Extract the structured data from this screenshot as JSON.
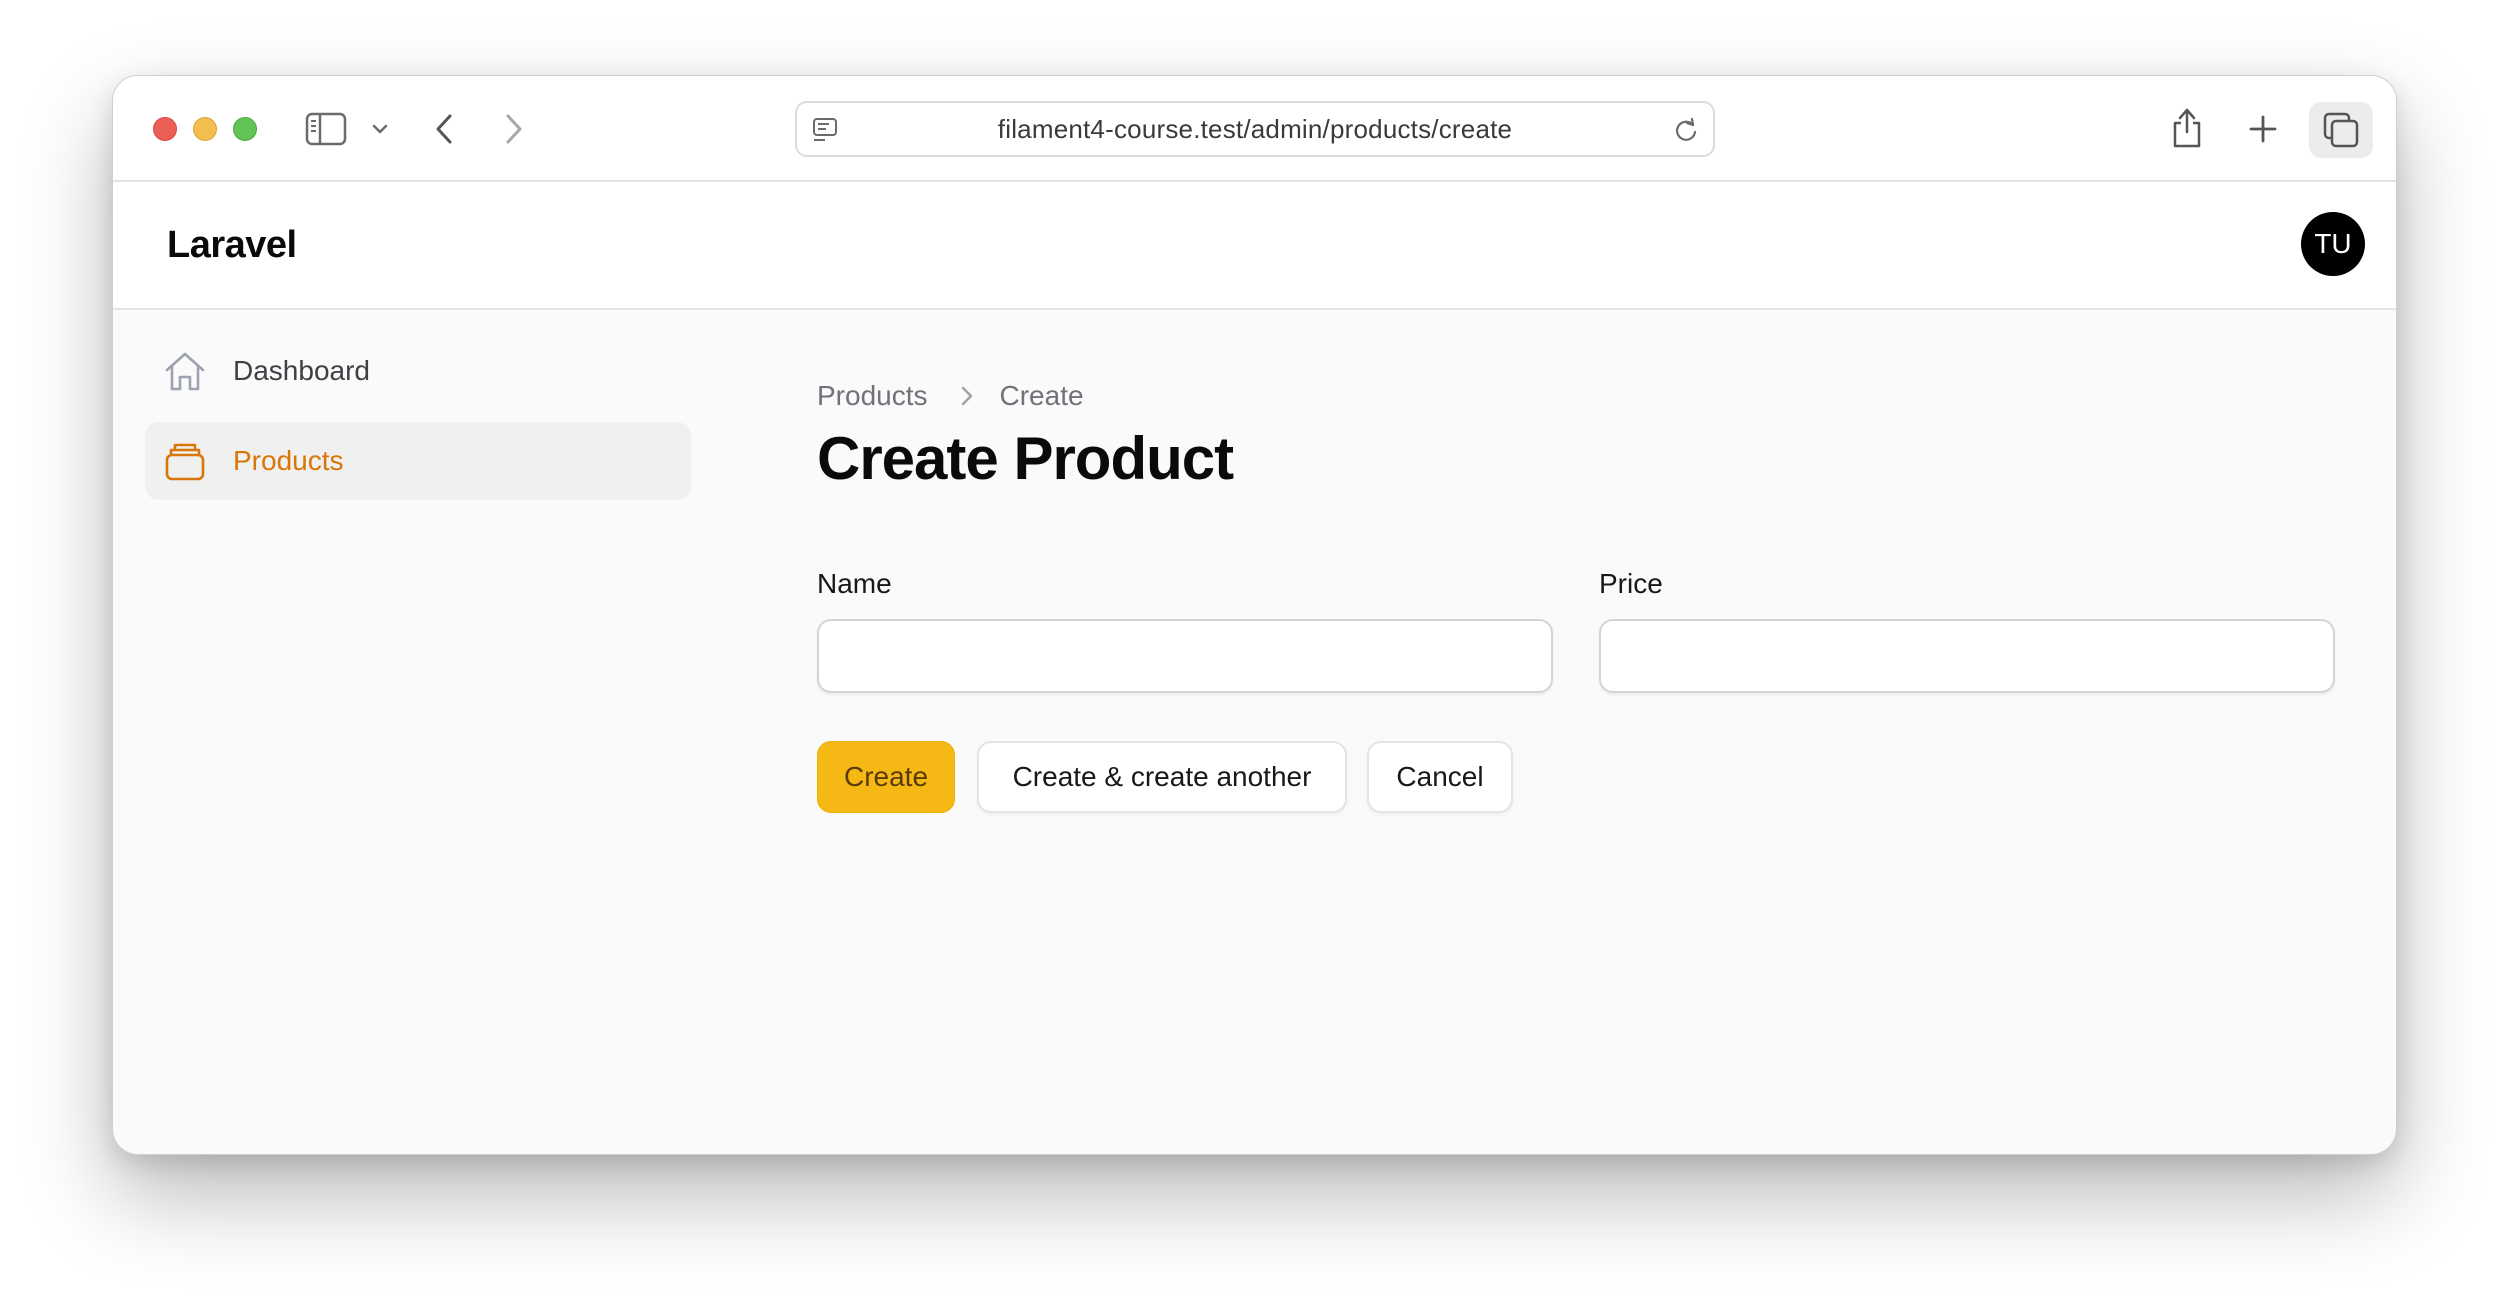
{
  "browser": {
    "url": "filament4-course.test/admin/products/create"
  },
  "app": {
    "brand": "Laravel",
    "user_initials": "TU"
  },
  "sidebar": {
    "items": [
      {
        "label": "Dashboard",
        "icon": "home-icon",
        "active": false
      },
      {
        "label": "Products",
        "icon": "archive-box-icon",
        "active": true
      }
    ]
  },
  "breadcrumb": {
    "items": [
      "Products",
      "Create"
    ]
  },
  "page": {
    "title": "Create Product"
  },
  "form": {
    "name": {
      "label": "Name",
      "value": ""
    },
    "price": {
      "label": "Price",
      "value": ""
    }
  },
  "actions": {
    "create": "Create",
    "create_another": "Create & create another",
    "cancel": "Cancel"
  },
  "colors": {
    "primary": "#f5b814",
    "active_nav_text": "#d97706",
    "avatar_bg": "#000000"
  }
}
